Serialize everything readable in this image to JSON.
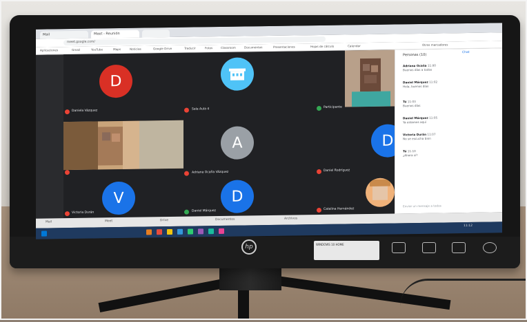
{
  "browser": {
    "tabs": [
      "Mail",
      "Meet - Reunión",
      "",
      ""
    ],
    "url": "meet.google.com/",
    "bookmarks": [
      "Aplicaciones",
      "Gmail",
      "YouTube",
      "Maps",
      "Noticias",
      "Google Drive",
      "Traducir",
      "Fotos",
      "Classroom",
      "Documentos",
      "Presentaciones",
      "Hojas de cálculo",
      "Calendar",
      "Otros marcadores"
    ]
  },
  "meeting": {
    "participants": [
      {
        "initial": "D",
        "name": "Daniela Vázquez",
        "color": "#d93025"
      },
      {
        "initial": "",
        "name": "Sala Aula 4",
        "color": "#4fc3f7"
      },
      {
        "initial": "",
        "name": "Participante",
        "color": "#8a6a5a"
      },
      {
        "initial": "",
        "name": "",
        "color": "#b98f5f"
      },
      {
        "initial": "A",
        "name": "Adriana Ocaña Vázquez",
        "color": "#9aa0a6"
      },
      {
        "initial": "D",
        "name": "Daniel Rodríguez",
        "color": "#1a73e8"
      },
      {
        "initial": "V",
        "name": "Victoria Durán",
        "color": "#1a73e8"
      },
      {
        "initial": "D",
        "name": "Daniel Márquez",
        "color": "#1a73e8"
      },
      {
        "initial": "",
        "name": "Catalina Hernández",
        "color": "#f0b27a"
      }
    ]
  },
  "side_panel": {
    "title": "Personas (10)",
    "chat_label": "Chat",
    "messages": [
      {
        "author": "Adriana Ocaña",
        "time": "11:00",
        "text": "Buenos días a todos"
      },
      {
        "author": "Daniel Márquez",
        "time": "11:02",
        "text": "Hola, buenos días"
      },
      {
        "author": "Tú",
        "time": "11:03",
        "text": "Buenos días"
      },
      {
        "author": "Daniel Márquez",
        "time": "11:05",
        "text": "Ya estamos aquí"
      },
      {
        "author": "Victoria Durán",
        "time": "11:07",
        "text": "No se escucha bien"
      },
      {
        "author": "Tú",
        "time": "11:10",
        "text": "¿Ahora sí?"
      }
    ],
    "input_placeholder": "Enviar un mensaje a todos"
  },
  "taskbar": {
    "items": [
      "Mail",
      "Meet",
      "Drive",
      "Documentos",
      "Archivos"
    ],
    "clock": "11:12"
  },
  "monitor": {
    "logo": "hp",
    "sticker": "WINDOWS 10 HOME"
  }
}
